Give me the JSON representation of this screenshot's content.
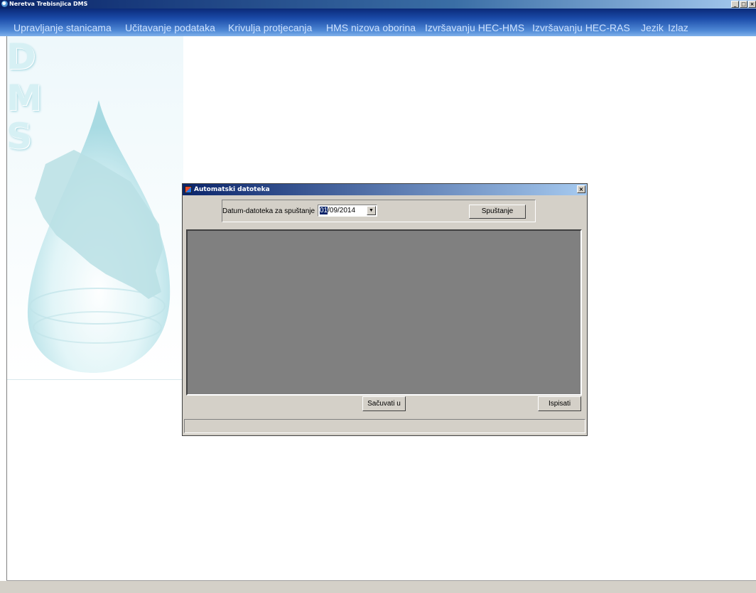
{
  "window": {
    "title": "Neretva Trebisnjica DMS",
    "controls": {
      "minimize": "_",
      "maximize": "□",
      "close": "×"
    }
  },
  "menu": {
    "items": [
      "Upravljanje stanicama",
      "Učitavanje podataka",
      "Krivulja protjecanja",
      "HMS nizova oborina",
      "Izvršavanju HEC-HMS",
      "Izvršavanju HEC-RAS",
      "Jezik",
      "Izlaz"
    ]
  },
  "logo": {
    "letters": [
      "D",
      "M",
      "S"
    ]
  },
  "dialog": {
    "title": "Automatski datoteka",
    "close": "×",
    "date_label": "Datum-datoteka za spuštanje",
    "date_day": "01",
    "date_rest": "/09/2014",
    "dropdown_arrow": "▼",
    "download_button": "Spuštanje",
    "save_button": "Sačuvati u",
    "print_button": "Ispisati"
  },
  "colors": {
    "titlebar_start": "#0a246a",
    "menubar": "#1a4aa8",
    "grid_background": "#808080",
    "dialog_background": "#d4d0c8"
  }
}
